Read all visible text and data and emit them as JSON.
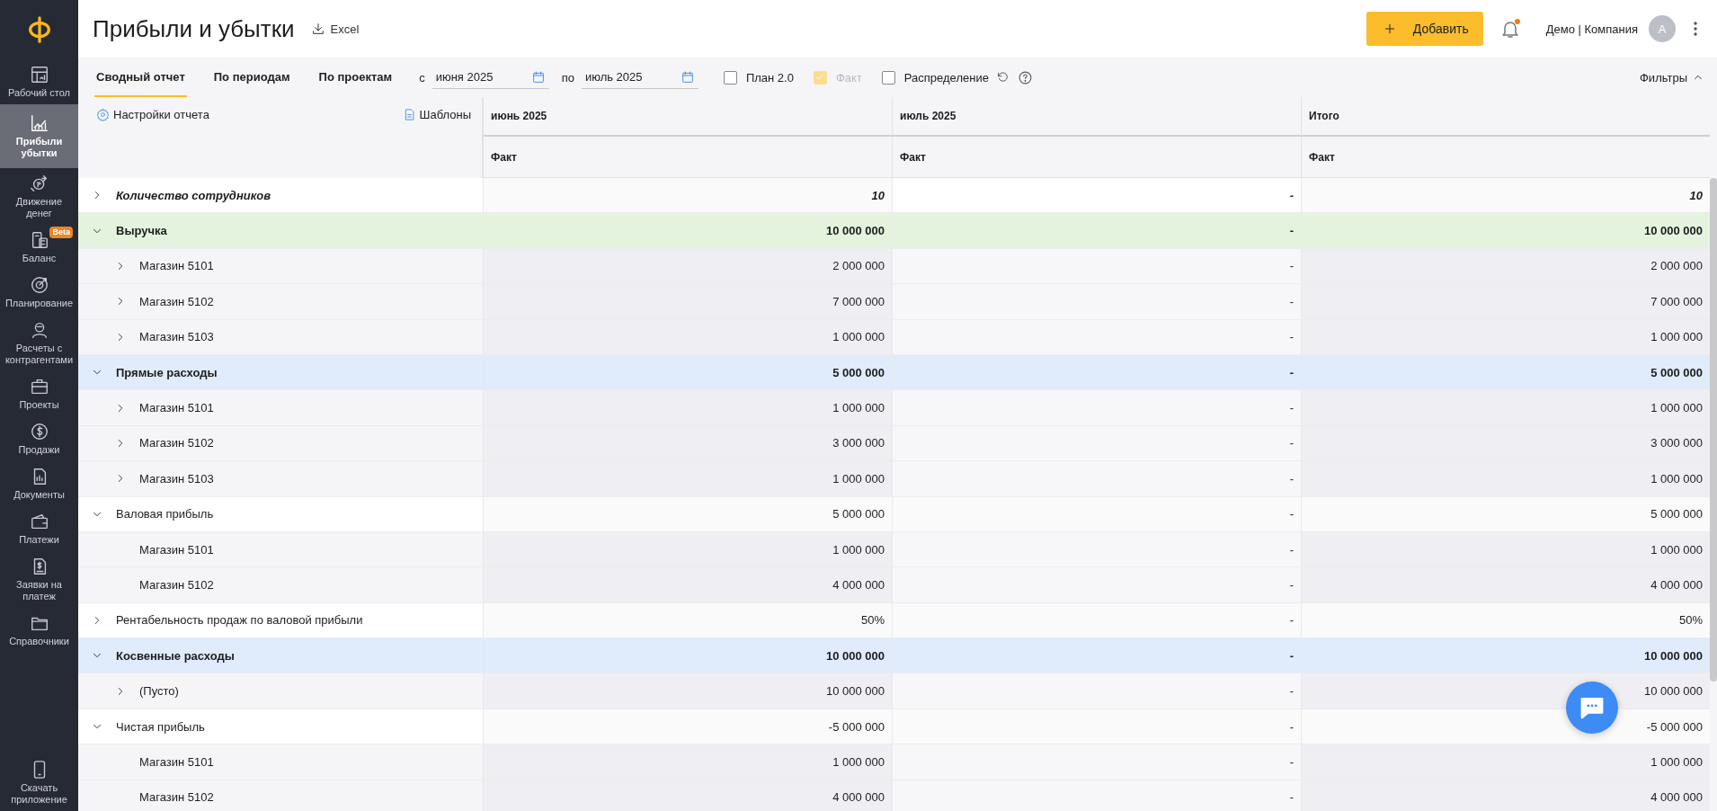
{
  "sidebar": {
    "items": [
      {
        "label": "Рабочий стол",
        "selected": false
      },
      {
        "label": "Прибыли убытки",
        "selected": true
      },
      {
        "label": "Движение денег",
        "selected": false
      },
      {
        "label": "Баланс",
        "selected": false,
        "badge": "Beta"
      },
      {
        "label": "Планирование",
        "selected": false
      },
      {
        "label": "Расчеты с контрагентами",
        "selected": false
      },
      {
        "label": "Проекты",
        "selected": false
      },
      {
        "label": "Продажи",
        "selected": false
      },
      {
        "label": "Документы",
        "selected": false
      },
      {
        "label": "Платежи",
        "selected": false
      },
      {
        "label": "Заявки на платеж",
        "selected": false
      },
      {
        "label": "Справочники",
        "selected": false
      }
    ],
    "footer": "Скачать приложение"
  },
  "header": {
    "title": "Прибыли и убытки",
    "export": "Excel",
    "add_button": "Добавить",
    "notifications_unread": true,
    "account": "Демо | Компания",
    "avatar": "A"
  },
  "toolbar": {
    "tabs": [
      {
        "label": "Сводный отчет",
        "selected": true
      },
      {
        "label": "По периодам",
        "selected": false
      },
      {
        "label": "По проектам",
        "selected": false
      }
    ],
    "from_label": "с",
    "from_value": "июня 2025",
    "to_label": "по",
    "to_value": "июль 2025",
    "checkboxes": [
      {
        "label": "План 2.0",
        "checked": false,
        "disabled": false
      },
      {
        "label": "Факт",
        "checked": true,
        "disabled": true
      },
      {
        "label": "Распределение",
        "checked": false,
        "disabled": false
      }
    ],
    "filters": "Фильтры"
  },
  "table": {
    "settings": "Настройки отчета",
    "templates": "Шаблоны",
    "columns": [
      {
        "period": "июнь 2025",
        "measure": "Факт"
      },
      {
        "period": "июль 2025",
        "measure": "Факт"
      },
      {
        "period": "Итого",
        "measure": "Факт"
      }
    ],
    "rows": [
      {
        "label": "Количество сотрудников",
        "kind": "metric",
        "expanded": false,
        "values": [
          "10",
          "-",
          "10"
        ]
      },
      {
        "label": "Выручка",
        "kind": "group",
        "color": "#e4f3de",
        "expanded": true,
        "values": [
          "10 000 000",
          "-",
          "10 000 000"
        ],
        "children": [
          {
            "label": "Магазин 5101",
            "kind": "item",
            "expanded": false,
            "values": [
              "2 000 000",
              "-",
              "2 000 000"
            ]
          },
          {
            "label": "Магазин 5102",
            "kind": "item",
            "expanded": false,
            "values": [
              "7 000 000",
              "-",
              "7 000 000"
            ]
          },
          {
            "label": "Магазин 5103",
            "kind": "item",
            "expanded": false,
            "values": [
              "1 000 000",
              "-",
              "1 000 000"
            ]
          }
        ]
      },
      {
        "label": "Прямые расходы",
        "kind": "group",
        "color": "#e0ebfb",
        "expanded": true,
        "values": [
          "5 000 000",
          "-",
          "5 000 000"
        ],
        "children": [
          {
            "label": "Магазин 5101",
            "kind": "item",
            "expanded": false,
            "values": [
              "1 000 000",
              "-",
              "1 000 000"
            ]
          },
          {
            "label": "Магазин 5102",
            "kind": "item",
            "expanded": false,
            "values": [
              "3 000 000",
              "-",
              "3 000 000"
            ]
          },
          {
            "label": "Магазин 5103",
            "kind": "item",
            "expanded": false,
            "values": [
              "1 000 000",
              "-",
              "1 000 000"
            ]
          }
        ]
      },
      {
        "label": "Валовая прибыль",
        "kind": "total",
        "expanded": true,
        "values": [
          "5 000 000",
          "-",
          "5 000 000"
        ],
        "children": [
          {
            "label": "Магазин 5101",
            "kind": "item",
            "values": [
              "1 000 000",
              "-",
              "1 000 000"
            ]
          },
          {
            "label": "Магазин 5102",
            "kind": "item",
            "values": [
              "4 000 000",
              "-",
              "4 000 000"
            ]
          }
        ]
      },
      {
        "label": "Рентабельность продаж по валовой прибыли",
        "kind": "total",
        "expanded": false,
        "values": [
          "50%",
          "-",
          "50%"
        ]
      },
      {
        "label": "Косвенные расходы",
        "kind": "group",
        "color": "#e0ebfb",
        "expanded": true,
        "values": [
          "10 000 000",
          "-",
          "10 000 000"
        ],
        "children": [
          {
            "label": "(Пусто)",
            "kind": "item",
            "expanded": false,
            "values": [
              "10 000 000",
              "-",
              "10 000 000"
            ]
          }
        ]
      },
      {
        "label": "Чистая прибыль",
        "kind": "total",
        "expanded": true,
        "values": [
          "-5 000 000",
          "-",
          "-5 000 000"
        ],
        "children": [
          {
            "label": "Магазин 5101",
            "kind": "item",
            "values": [
              "1 000 000",
              "-",
              "1 000 000"
            ]
          },
          {
            "label": "Магазин 5102",
            "kind": "item",
            "values": [
              "4 000 000",
              "-",
              "4 000 000"
            ]
          }
        ]
      }
    ]
  }
}
